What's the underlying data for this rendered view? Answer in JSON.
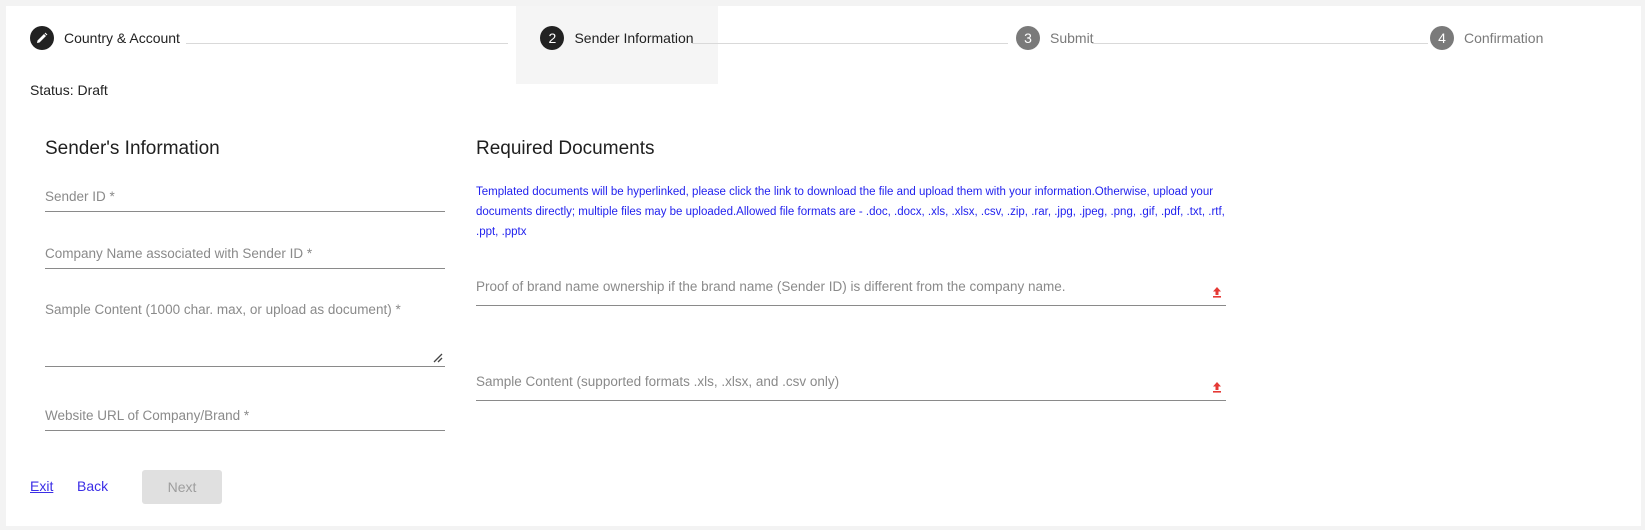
{
  "stepper": {
    "steps": [
      {
        "number": "",
        "label": "Country & Account",
        "state": "done",
        "icon": "pencil-icon"
      },
      {
        "number": "2",
        "label": "Sender Information",
        "state": "active"
      },
      {
        "number": "3",
        "label": "Submit",
        "state": "todo"
      },
      {
        "number": "4",
        "label": "Confirmation",
        "state": "todo"
      }
    ]
  },
  "status": "Status: Draft",
  "sender": {
    "title": "Sender's Information",
    "fields": {
      "sender_id": "Sender ID *",
      "company_name": "Company Name associated with Sender ID *",
      "sample_content": "Sample Content (1000 char. max, or upload as document) *",
      "website_url": "Website URL of Company/Brand *"
    }
  },
  "documents": {
    "title": "Required Documents",
    "note": "Templated documents will be hyperlinked, please click the link to download the file and upload them with your information.Otherwise, upload your documents directly; multiple files may be uploaded.Allowed file formats are - .doc, .docx, .xls, .xlsx, .csv, .zip, .rar, .jpg, .jpeg, .png, .gif, .pdf, .txt, .rtf, .ppt, .pptx",
    "proof_field": "Proof of brand name ownership if the brand name (Sender ID) is different from the company name.",
    "sample_field": "Sample Content (supported formats .xls, .xlsx, and .csv only)"
  },
  "footer": {
    "exit": "Exit",
    "back": "Back",
    "next": "Next"
  },
  "colors": {
    "link": "#3b2ee6",
    "note": "#2222ee",
    "upload_icon": "#e53935"
  }
}
